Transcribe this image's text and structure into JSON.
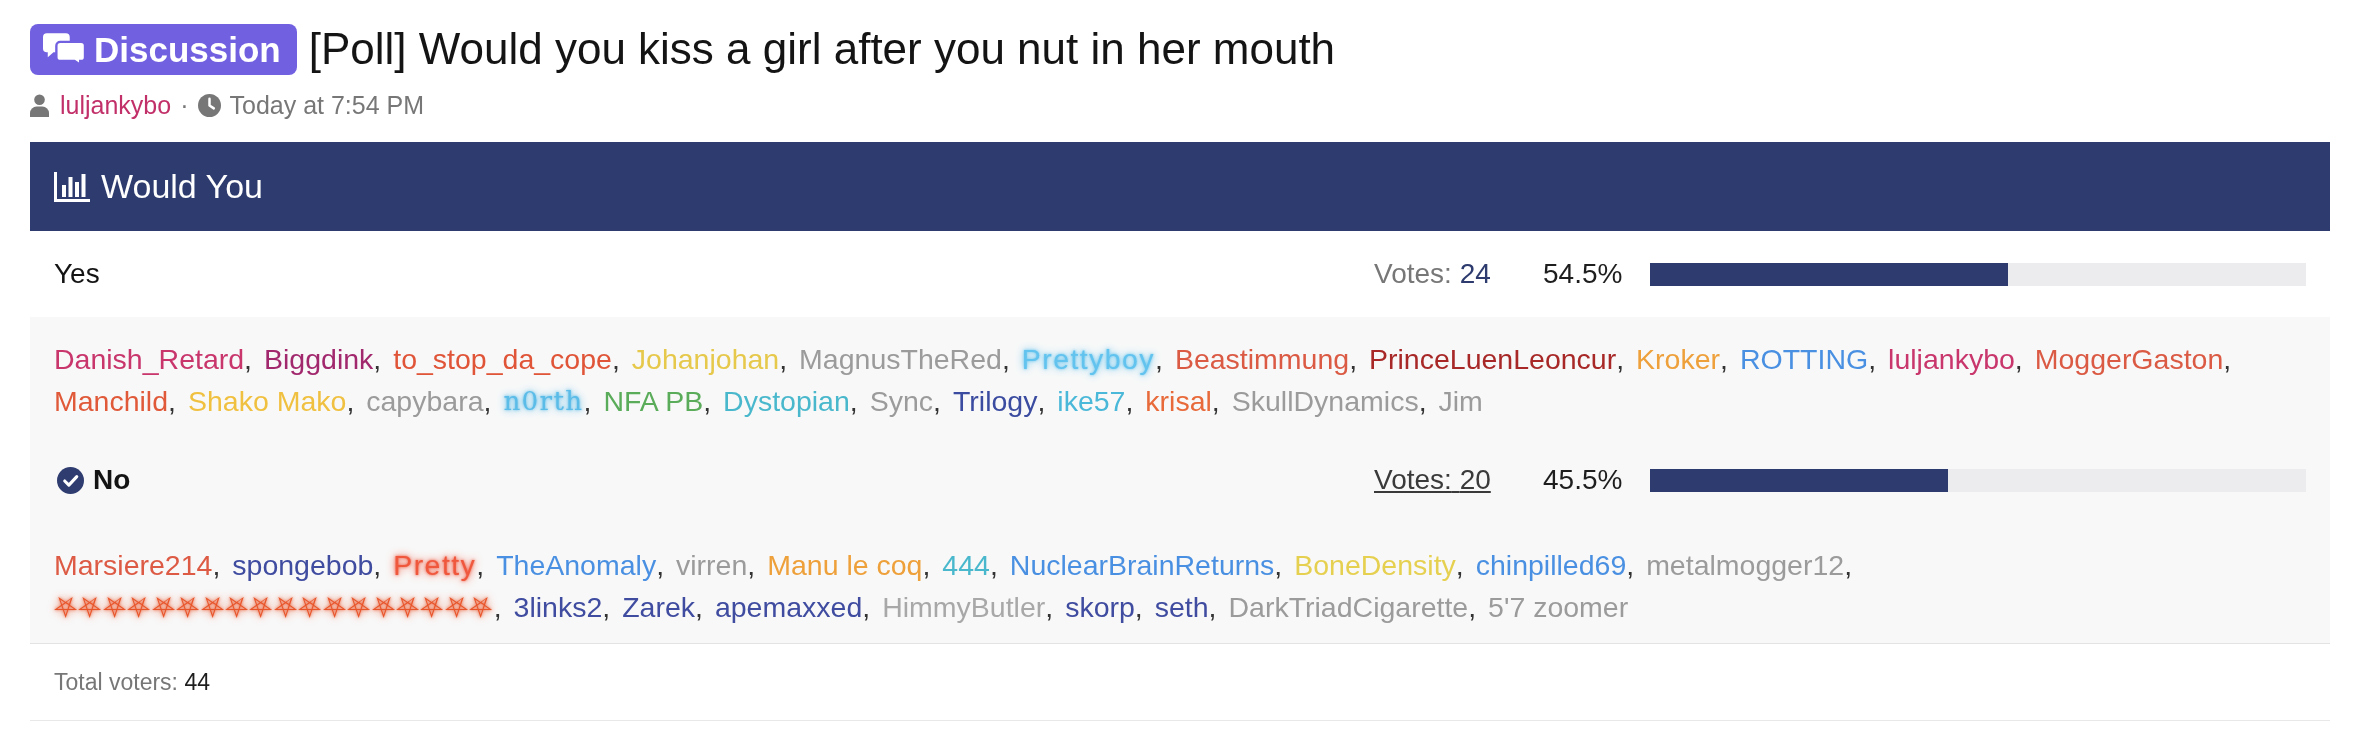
{
  "thread": {
    "prefix": "Discussion",
    "title": "[Poll] Would you kiss a girl after you nut in her mouth",
    "author": "luljankybo",
    "separator": "·",
    "time": "Today at 7:54 PM"
  },
  "poll": {
    "title": "Would You",
    "name_separator": ",",
    "options": [
      {
        "label": "Yes",
        "voted": false,
        "hovered": false,
        "votes_label": "Votes:",
        "votes": "24",
        "percent": "54.5%",
        "level": 0.545,
        "voter_lines": [
          [
            {
              "name": "Danish_Retard",
              "kind": "plain",
              "color": "#c8366c"
            },
            {
              "name": "Biggdink",
              "kind": "plain",
              "color": "#a2286e"
            },
            {
              "name": "to_stop_da_cope",
              "kind": "plain",
              "color": "#e05438"
            },
            {
              "name": "Johanjohan",
              "kind": "plain",
              "color": "#e6c84a"
            },
            {
              "name": "MagnusTheRed",
              "kind": "plain",
              "color": "#9b9b9b"
            },
            {
              "name": "Prettyboy",
              "kind": "glow",
              "color": "#62c3ee"
            },
            {
              "name": "Beastimmung",
              "kind": "plain",
              "color": "#db5a44"
            },
            {
              "name": "PrinceLuenLeoncur",
              "kind": "plain",
              "color": "#a82828"
            },
            {
              "name": "Kroker",
              "kind": "plain",
              "color": "#eea03a"
            },
            {
              "name": "ROTTING",
              "kind": "plain",
              "color": "#4a90e2"
            },
            {
              "name": "luljankybo",
              "kind": "plain",
              "color": "#c8366c"
            },
            {
              "name": "MoggerGaston",
              "kind": "plain",
              "color": "#db5a44"
            }
          ],
          [
            {
              "name": "Manchild",
              "kind": "plain",
              "color": "#e05a3a"
            },
            {
              "name": "Shako Mako",
              "kind": "plain",
              "color": "#f0c040"
            },
            {
              "name": "capybara",
              "kind": "plain",
              "color": "#9b9b9b"
            },
            {
              "name": "n0rth",
              "kind": "serifglow",
              "color": "#5bbce8"
            },
            {
              "name": "NFA PB",
              "kind": "plain",
              "color": "#5aac5a"
            },
            {
              "name": "Dystopian",
              "kind": "plain",
              "color": "#4ab8cc"
            },
            {
              "name": "Sync",
              "kind": "plain",
              "color": "#9b9b9b"
            },
            {
              "name": "Trilogy",
              "kind": "plain",
              "color": "#3a4ba0"
            },
            {
              "name": "ike57",
              "kind": "plain",
              "color": "#4ab8d8"
            },
            {
              "name": "krisal",
              "kind": "plain",
              "color": "#e86a3a"
            },
            {
              "name": "SkullDynamics",
              "kind": "plain",
              "color": "#9b9b9b"
            },
            {
              "name": "Jim",
              "kind": "plain",
              "color": "#9b9b9b"
            }
          ]
        ]
      },
      {
        "label": "No",
        "voted": true,
        "hovered": true,
        "votes_label": "Votes:",
        "votes": "20",
        "percent": "45.5%",
        "level": 0.455,
        "voter_lines": [
          [
            {
              "name": "Marsiere214",
              "kind": "plain",
              "color": "#dd5a44"
            },
            {
              "name": "spongebob",
              "kind": "plain",
              "color": "#3f4ca0"
            },
            {
              "name": "Pretty",
              "kind": "glow",
              "color": "#f0583e"
            },
            {
              "name": "TheAnomaly",
              "kind": "plain",
              "color": "#4a90e2"
            },
            {
              "name": "virren",
              "kind": "plain",
              "color": "#9b9b9b"
            },
            {
              "name": "Manu le coq",
              "kind": "plain",
              "color": "#eea03a"
            },
            {
              "name": "444",
              "kind": "plain",
              "color": "#4ab8cc"
            },
            {
              "name": "NuclearBrainReturns",
              "kind": "plain",
              "color": "#4a90e2"
            },
            {
              "name": "BoneDensity",
              "kind": "plain",
              "color": "#e6d050"
            },
            {
              "name": "chinpilled69",
              "kind": "plain",
              "color": "#4a90e2"
            },
            {
              "name": "metalmogger12",
              "kind": "plain",
              "color": "#9b9b9b"
            }
          ],
          [
            {
              "name": "⛧⛧⛧⛧⛧⛧⛧⛧⛧⛧⛧⛧⛧⛧⛧⛧⛧⛧",
              "kind": "glow",
              "color": "#e8542a"
            },
            {
              "name": "3links2",
              "kind": "plain",
              "color": "#3f4ca0"
            },
            {
              "name": "Zarek",
              "kind": "plain",
              "color": "#3f4ca0"
            },
            {
              "name": "apemaxxed",
              "kind": "plain",
              "color": "#3f4ca0"
            },
            {
              "name": "HimmyButler",
              "kind": "plain",
              "color": "#a8a8a8"
            },
            {
              "name": "skorp",
              "kind": "plain",
              "color": "#3f4ca0"
            },
            {
              "name": "seth",
              "kind": "plain",
              "color": "#3f4ca0"
            },
            {
              "name": "DarkTriadCigarette",
              "kind": "plain",
              "color": "#9b9b9b"
            },
            {
              "name": "5'7 zoomer",
              "kind": "plain",
              "color": "#9b9b9b"
            }
          ]
        ]
      }
    ],
    "total_label": "Total voters:",
    "total": "44"
  }
}
